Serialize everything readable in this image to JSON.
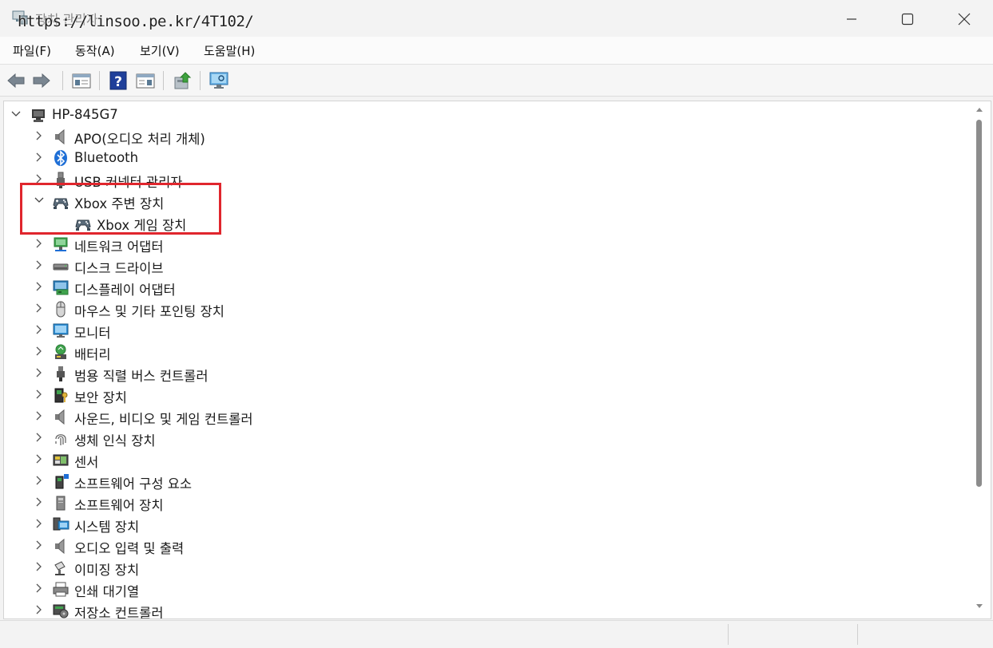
{
  "window": {
    "title": "장치 관리자",
    "watermark": "https://linsoo.pe.kr/4T102/"
  },
  "menu": {
    "items": [
      {
        "label": "파일(F)"
      },
      {
        "label": "동작(A)"
      },
      {
        "label": "보기(V)"
      },
      {
        "label": "도움말(H)"
      }
    ]
  },
  "toolbar": {
    "buttons": [
      {
        "icon": "back-arrow-icon"
      },
      {
        "icon": "forward-arrow-icon"
      },
      {
        "icon": "properties-panel-icon"
      },
      {
        "icon": "help-icon"
      },
      {
        "icon": "details-view-icon"
      },
      {
        "icon": "update-driver-icon"
      },
      {
        "icon": "scan-monitor-icon"
      }
    ]
  },
  "tree": {
    "root": {
      "label": "HP-845G7",
      "expanded": true,
      "icon": "computer-icon"
    },
    "items": [
      {
        "label": "APO(오디오 처리 개체)",
        "icon": "speaker-icon",
        "expanded": false
      },
      {
        "label": "Bluetooth",
        "icon": "bluetooth-icon",
        "expanded": false
      },
      {
        "label": "USB 커넥터 관리자",
        "icon": "usb-icon",
        "expanded": false
      },
      {
        "label": "Xbox 주변 장치",
        "icon": "gamepad-icon",
        "expanded": true,
        "children": [
          {
            "label": "Xbox 게임 장치",
            "icon": "gamepad-icon"
          }
        ]
      },
      {
        "label": "네트워크 어댑터",
        "icon": "network-icon",
        "expanded": false
      },
      {
        "label": "디스크 드라이브",
        "icon": "disk-drive-icon",
        "expanded": false
      },
      {
        "label": "디스플레이 어댑터",
        "icon": "display-adapter-icon",
        "expanded": false
      },
      {
        "label": "마우스 및 기타 포인팅 장치",
        "icon": "mouse-icon",
        "expanded": false
      },
      {
        "label": "모니터",
        "icon": "monitor-icon",
        "expanded": false
      },
      {
        "label": "배터리",
        "icon": "battery-icon",
        "expanded": false
      },
      {
        "label": "범용 직렬 버스 컨트롤러",
        "icon": "usb-controller-icon",
        "expanded": false
      },
      {
        "label": "보안 장치",
        "icon": "security-key-icon",
        "expanded": false
      },
      {
        "label": "사운드, 비디오 및 게임 컨트롤러",
        "icon": "sound-icon",
        "expanded": false
      },
      {
        "label": "생체 인식 장치",
        "icon": "fingerprint-icon",
        "expanded": false
      },
      {
        "label": "센서",
        "icon": "sensor-icon",
        "expanded": false
      },
      {
        "label": "소프트웨어 구성 요소",
        "icon": "software-component-icon",
        "expanded": false
      },
      {
        "label": "소프트웨어 장치",
        "icon": "software-device-icon",
        "expanded": false
      },
      {
        "label": "시스템 장치",
        "icon": "system-device-icon",
        "expanded": false
      },
      {
        "label": "오디오 입력 및 출력",
        "icon": "audio-io-icon",
        "expanded": false
      },
      {
        "label": "이미징 장치",
        "icon": "camera-icon",
        "expanded": false
      },
      {
        "label": "인쇄 대기열",
        "icon": "printer-icon",
        "expanded": false
      },
      {
        "label": "저장소 컨트롤러",
        "icon": "storage-controller-icon",
        "expanded": false
      }
    ]
  },
  "colors": {
    "highlight": "#e0262d",
    "bluetooth": "#1f6fd6"
  }
}
